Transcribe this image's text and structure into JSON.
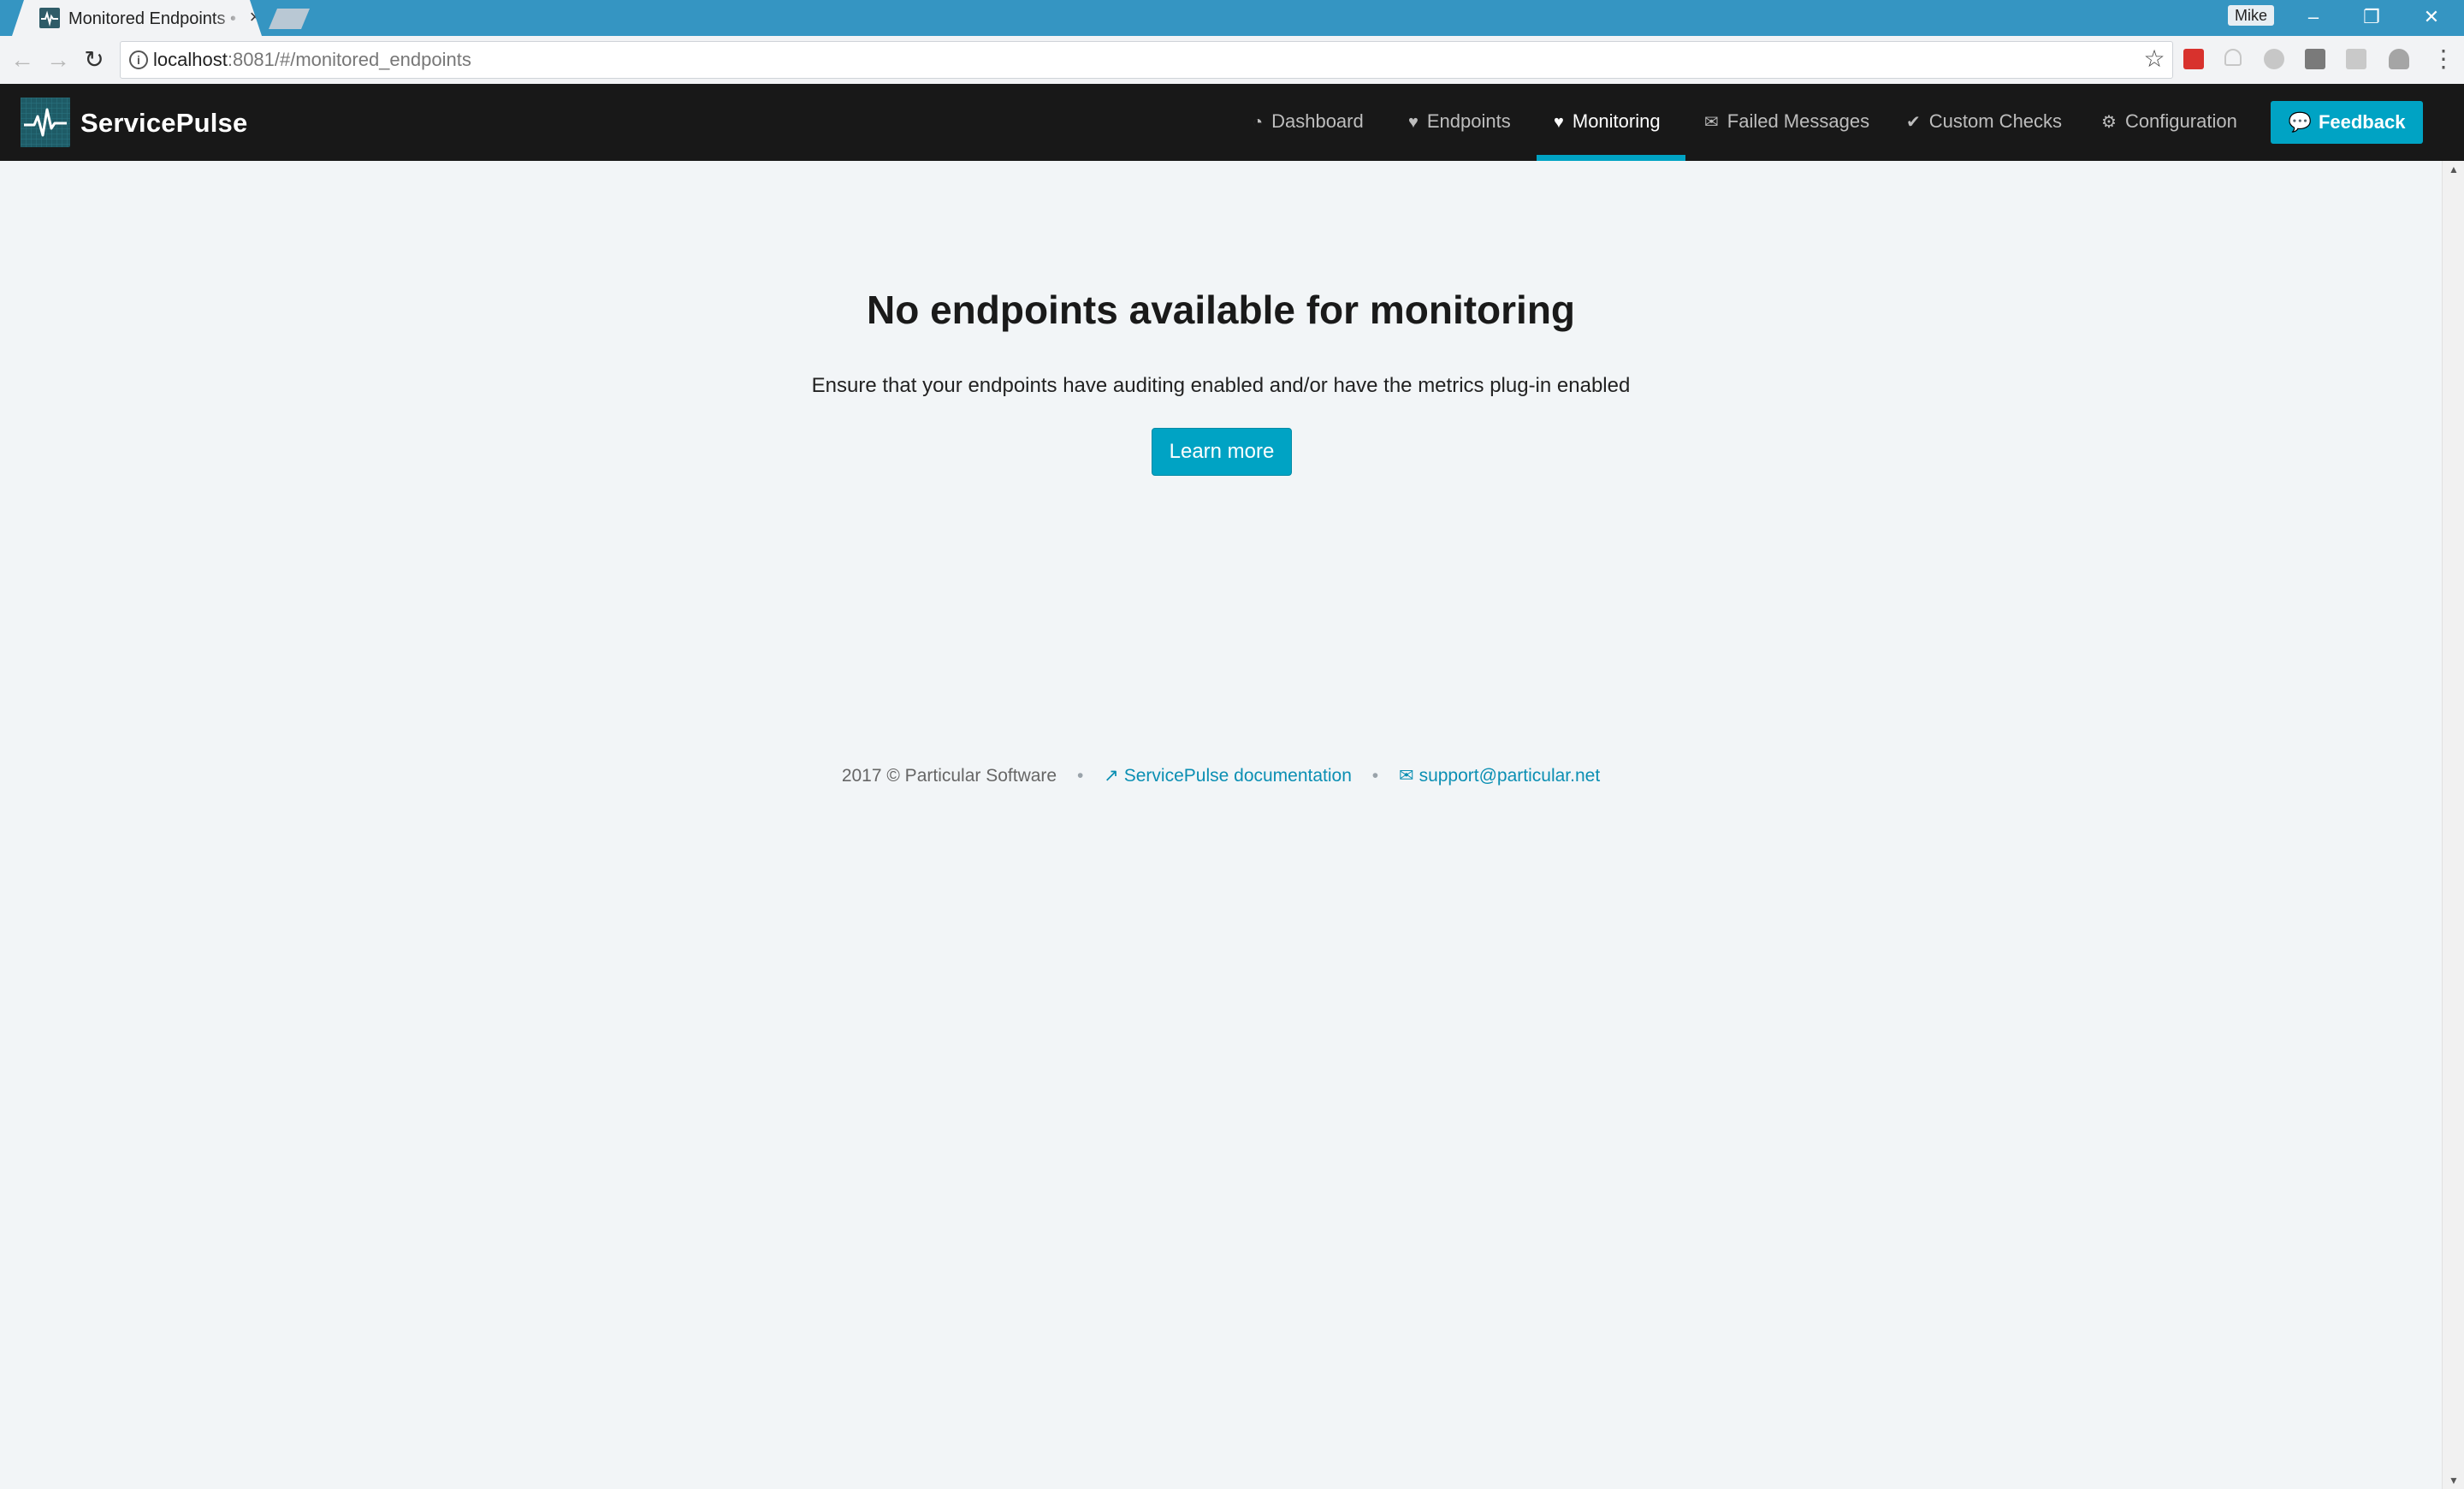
{
  "browser": {
    "tab_title": "Monitored Endpoints • ServicePulse",
    "tab_close": "×",
    "profile_name": "Mike",
    "window_controls": {
      "minimize": "–",
      "restore": "❐",
      "close": "✕"
    },
    "url_host": "localhost",
    "url_rest": ":8081/#/monitored_endpoints",
    "nav": {
      "back": "←",
      "forward": "→",
      "reload": "↻"
    },
    "icons": {
      "info": "info-icon",
      "star": "star-icon",
      "menu": "more-vert-icon"
    }
  },
  "app": {
    "brand": "ServicePulse",
    "accent_color": "#00a3c4",
    "nav_items": [
      {
        "label": "Dashboard",
        "icon": "dashboard-icon"
      },
      {
        "label": "Endpoints",
        "icon": "heart-icon"
      },
      {
        "label": "Monitoring",
        "icon": "heartbeat-icon",
        "active": true
      },
      {
        "label": "Failed Messages",
        "icon": "envelope-icon"
      },
      {
        "label": "Custom Checks",
        "icon": "check-icon"
      },
      {
        "label": "Configuration",
        "icon": "gear-icon"
      }
    ],
    "feedback_label": "Feedback"
  },
  "main": {
    "heading": "No endpoints available for monitoring",
    "subtext": "Ensure that your endpoints have auditing enabled and/or have the metrics plug-in enabled",
    "learn_more_label": "Learn more"
  },
  "footer": {
    "copyright": "2017 © Particular Software",
    "docs_link": "ServicePulse documentation",
    "support_link": "support@particular.net",
    "separator": "•"
  }
}
